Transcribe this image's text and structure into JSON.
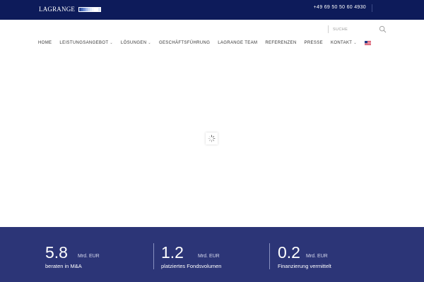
{
  "brand": {
    "name": "LAGRANGE",
    "mark_colors": [
      "#0d1b5a",
      "#2c4a9a",
      "#5a7cc8",
      "#9fb6e6",
      "#dfe8f7"
    ]
  },
  "topbar": {
    "phone": "+49 69 50 50 60 4930",
    "background": "#0d1b5a"
  },
  "search": {
    "placeholder": "SUCHE",
    "icon": "search-icon"
  },
  "nav": {
    "items": [
      {
        "label": "HOME",
        "has_dropdown": false
      },
      {
        "label": "LEISTUNGSANGEBOT",
        "has_dropdown": true
      },
      {
        "label": "LÖSUNGEN",
        "has_dropdown": true
      },
      {
        "label": "GESCHÄFTSFÜHRUNG",
        "has_dropdown": false
      },
      {
        "label": "LAGRANGE TEAM",
        "has_dropdown": false
      },
      {
        "label": "REFERENZEN",
        "has_dropdown": false
      },
      {
        "label": "PRESSE",
        "has_dropdown": false
      },
      {
        "label": "KONTAKT",
        "has_dropdown": true
      }
    ],
    "language_flag": "us-flag-icon"
  },
  "loader": {
    "icon": "loading-spinner-icon"
  },
  "stats": {
    "background": "#2c3577",
    "items": [
      {
        "value": "5.8",
        "unit": "Mrd. EUR",
        "label": "beraten in M&A"
      },
      {
        "value": "1.2",
        "unit": "Mrd. EUR",
        "label": "platziertes Fondsvolumen"
      },
      {
        "value": "0.2",
        "unit": "Mrd. EUR",
        "label": "Finanzierung vermittelt"
      }
    ]
  }
}
